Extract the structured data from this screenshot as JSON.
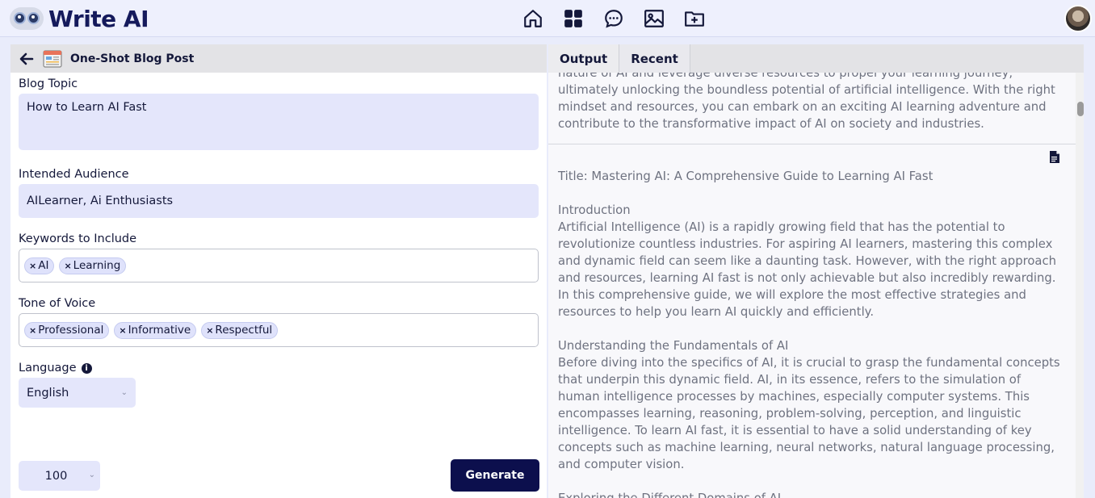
{
  "brand": {
    "name": "Write AI"
  },
  "nav": {
    "icons": [
      "home-icon",
      "dashboard-grid-icon",
      "chat-icon",
      "image-icon",
      "folder-add-icon"
    ]
  },
  "left": {
    "title": "One-Shot Blog Post",
    "blog_topic": {
      "label": "Blog Topic",
      "value": "How to Learn AI Fast"
    },
    "audience": {
      "label": "Intended Audience",
      "value": "AILearner, Ai Enthusiasts"
    },
    "keywords": {
      "label": "Keywords to Include",
      "tags": [
        "AI",
        "Learning"
      ]
    },
    "tone": {
      "label": "Tone of Voice",
      "tags": [
        "Professional",
        "Informative",
        "Respectful"
      ]
    },
    "language": {
      "label": "Language",
      "value": "English"
    },
    "word_count": "100",
    "generate_label": "Generate"
  },
  "right": {
    "tabs": [
      "Output",
      "Recent"
    ],
    "entry1": "nature of AI and leverage diverse resources to propel your learning journey, ultimately unlocking the boundless potential of artificial intelligence. With the right mindset and resources, you can embark on an exciting AI learning adventure and contribute to the transformative impact of AI on society and industries.",
    "entry2": {
      "title": "Title: Mastering AI: A Comprehensive Guide to Learning AI Fast",
      "intro_heading": "Introduction",
      "intro_body": "Artificial Intelligence (AI) is a rapidly growing field that has the potential to revolutionize countless industries. For aspiring AI learners, mastering this complex and dynamic field can seem like a daunting task. However, with the right approach and resources, learning AI fast is not only achievable but also incredibly rewarding. In this comprehensive guide, we will explore the most effective strategies and resources to help you learn AI quickly and efficiently.",
      "fund_heading": "Understanding the Fundamentals of AI",
      "fund_body": "Before diving into the specifics of AI, it is crucial to grasp the fundamental concepts that underpin this dynamic field. AI, in its essence, refers to the simulation of human intelligence processes by machines, especially computer systems. This encompasses learning, reasoning, problem-solving, perception, and linguistic intelligence. To learn AI fast, it is essential to have a solid understanding of key concepts such as machine learning, neural networks, natural language processing, and computer vision.",
      "domains_heading": "Exploring the Different Domains of AI"
    }
  }
}
